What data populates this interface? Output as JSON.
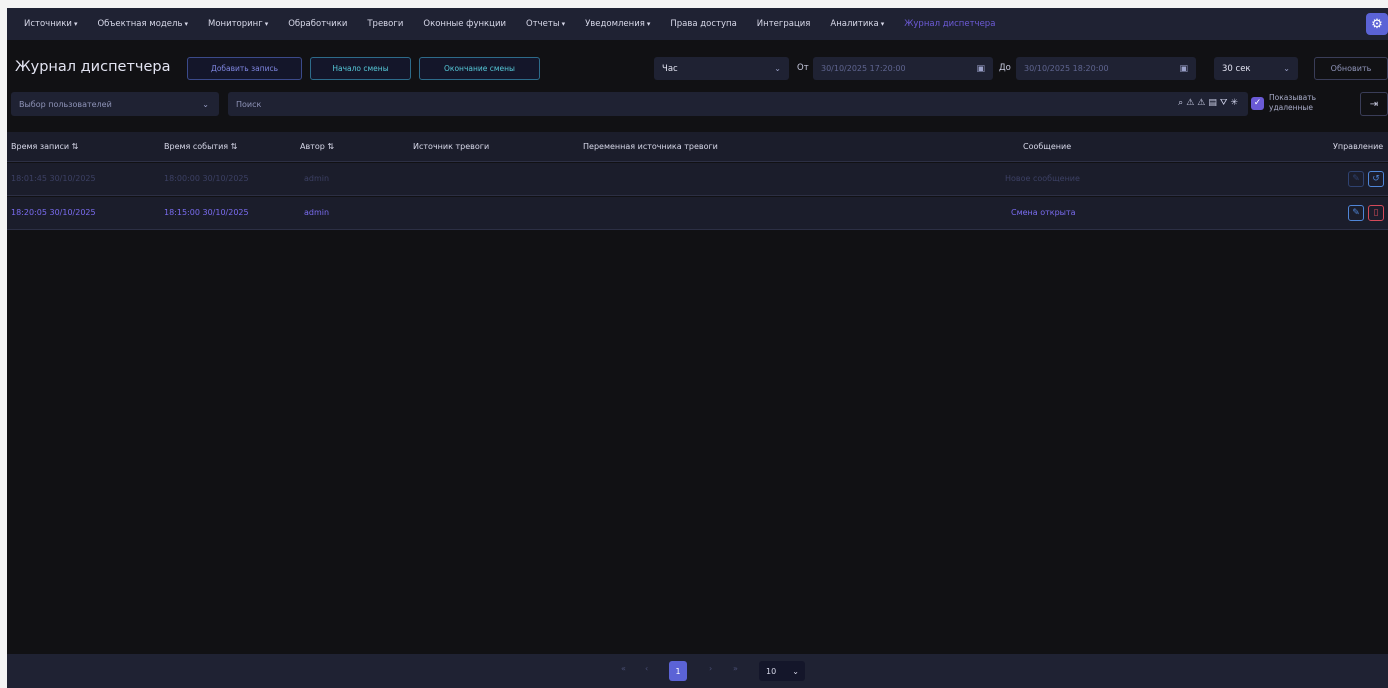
{
  "nav": {
    "items": [
      {
        "label": "Источники",
        "dropdown": true
      },
      {
        "label": "Объектная модель",
        "dropdown": true
      },
      {
        "label": "Мониторинг",
        "dropdown": true
      },
      {
        "label": "Обработчики",
        "dropdown": false
      },
      {
        "label": "Тревоги",
        "dropdown": false
      },
      {
        "label": "Оконные функции",
        "dropdown": false
      },
      {
        "label": "Отчеты",
        "dropdown": true
      },
      {
        "label": "Уведомления",
        "dropdown": true
      },
      {
        "label": "Права доступа",
        "dropdown": false
      },
      {
        "label": "Интеграция",
        "dropdown": false
      },
      {
        "label": "Аналитика",
        "dropdown": true
      },
      {
        "label": "Журнал диспетчера",
        "dropdown": false,
        "active": true
      }
    ],
    "settings_icon": "gear-icon"
  },
  "toolbar": {
    "title": "Журнал диспетчера",
    "add_label": "Добавить запись",
    "start_shift_label": "Начало смены",
    "end_shift_label": "Окончание смены",
    "period_value": "Час",
    "from_label": "От",
    "from_value": "30/10/2025 17:20:00",
    "to_label": "До",
    "to_value": "30/10/2025 18:20:00",
    "interval_value": "30 сек",
    "refresh_label": "Обновить"
  },
  "filters": {
    "user_select_placeholder": "Выбор пользователей",
    "search_placeholder": "Поиск",
    "show_deleted_label_1": "Показывать",
    "show_deleted_label_2": "удаленные",
    "show_deleted_checked": true
  },
  "table": {
    "columns": [
      "Время записи ⇅",
      "Время события ⇅",
      "Автор ⇅",
      "Источник тревоги",
      "Переменная источника тревоги",
      "Сообщение",
      "Управление"
    ],
    "rows": [
      {
        "record_time": "18:01:45 30/10/2025",
        "event_time": "18:00:00 30/10/2025",
        "author": "admin",
        "source": "",
        "variable": "",
        "message": "Новое сообщение",
        "deleted": true
      },
      {
        "record_time": "18:20:05 30/10/2025",
        "event_time": "18:15:00 30/10/2025",
        "author": "admin",
        "source": "",
        "variable": "",
        "message": "Смена открыта",
        "deleted": false
      }
    ]
  },
  "pagination": {
    "first": "«",
    "prev": "‹",
    "current_page": "1",
    "next": "›",
    "last": "»",
    "per_page": "10"
  },
  "colors": {
    "accent": "#5b63d6",
    "active_text": "#7a6cf0",
    "delete": "#d54a5a",
    "edit": "#4f86d8"
  }
}
